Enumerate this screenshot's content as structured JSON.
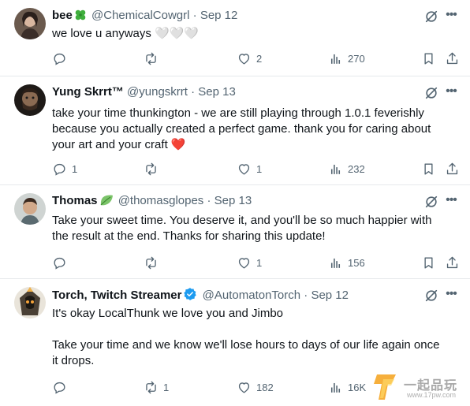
{
  "tweets": [
    {
      "name": "bee",
      "badge_icon": "four-leaf-clover-emoji",
      "handle": "@ChemicalCowgrl",
      "time": "Sep 12",
      "lines": [
        "we love u anyways 🤍🤍🤍"
      ],
      "replies": "",
      "retweets": "",
      "likes": "2",
      "views": "270"
    },
    {
      "name": "Yung Skrrt™",
      "badge_icon": "",
      "handle": "@yungskrrt",
      "time": "Sep 13",
      "lines": [
        "take your time thunkington - we are still playing through 1.0.1 feverishly because you actually created a perfect game. thank you for caring about your art and your craft ❤️"
      ],
      "replies": "1",
      "retweets": "",
      "likes": "1",
      "views": "232"
    },
    {
      "name": "Thomas",
      "badge_icon": "leaf-emoji",
      "handle": "@thomasglopes",
      "time": "Sep 13",
      "lines": [
        "Take your sweet time. You deserve it, and you'll be so much happier with the result at the end. Thanks for sharing this update!"
      ],
      "replies": "",
      "retweets": "",
      "likes": "1",
      "views": "156"
    },
    {
      "name": "Torch, Twitch Streamer",
      "badge_icon": "verified-badge-icon",
      "handle": "@AutomatonTorch",
      "time": "Sep 12",
      "lines": [
        "It's okay LocalThunk we love you and Jimbo",
        "Take your time and we know we'll lose hours to days of our life again once it drops."
      ],
      "replies": "",
      "retweets": "1",
      "likes": "182",
      "views": "16K"
    }
  ],
  "separator": "·",
  "watermark": {
    "text": "一起品玩",
    "url": "www.17pw.com"
  },
  "colors": {
    "text": "#0f1419",
    "muted": "#536471",
    "verified": "#1d9bf0",
    "divider": "#e6e9ec"
  }
}
